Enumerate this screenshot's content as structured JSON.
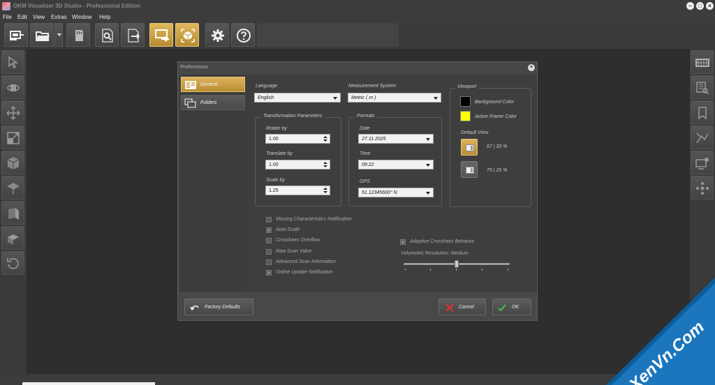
{
  "app": {
    "title": "OKM Visualizer 3D Studio - Professional Edition"
  },
  "window_controls": {
    "minimize": "–",
    "maximize": "□",
    "close": "×"
  },
  "menu": [
    "File",
    "Edit",
    "View",
    "Extras",
    "Window",
    "Help"
  ],
  "toolbar": {
    "buttons": [
      {
        "name": "connect-device",
        "icon": "device-connect-icon",
        "active": false
      },
      {
        "name": "open-file",
        "icon": "folder-open-icon",
        "active": false
      },
      {
        "name": "sd-card",
        "icon": "sd-card-icon",
        "active": false
      },
      {
        "name": "search-scan",
        "icon": "search-document-icon",
        "active": false
      },
      {
        "name": "export",
        "icon": "export-document-icon",
        "active": false
      },
      {
        "name": "screenshot",
        "icon": "screen-capture-icon",
        "active": true
      },
      {
        "name": "3d-view",
        "icon": "cube-select-icon",
        "active": true
      },
      {
        "name": "settings",
        "icon": "gear-icon",
        "active": false
      },
      {
        "name": "help",
        "icon": "question-icon",
        "active": false
      }
    ]
  },
  "dialog": {
    "title": "Preferences",
    "close": "×",
    "nav": [
      {
        "label": "General",
        "active": true
      },
      {
        "label": "Folders",
        "active": false
      }
    ],
    "language": {
      "label": "Language",
      "value": "English"
    },
    "measurement": {
      "label": "Measurement System",
      "value": "Metric ( m )"
    },
    "transformation": {
      "title": "Transformation Parameters",
      "rotate": {
        "label": "Rotate by",
        "value": "1.00"
      },
      "translate": {
        "label": "Translate by",
        "value": "1.00"
      },
      "scale": {
        "label": "Scale by",
        "value": "1.25"
      }
    },
    "formats": {
      "title": "Formats",
      "date": {
        "label": "Date",
        "value": "27.11.2025"
      },
      "time": {
        "label": "Time",
        "value": "09:22"
      },
      "gps": {
        "label": "GPS",
        "value": "51.12345600° N"
      }
    },
    "viewport": {
      "title": "Viewport",
      "background_color": {
        "label": "Background Color",
        "color": "#000000"
      },
      "active_frame_color": {
        "label": "Active Frame Color",
        "color": "#ffff00"
      },
      "default_view_label": "Default View",
      "views": [
        {
          "label": "67  |  33 %",
          "active": true
        },
        {
          "label": "75  |  25 %",
          "active": false
        }
      ]
    },
    "checkboxes": [
      {
        "label": "Missing Characteristics Notification",
        "checked": false
      },
      {
        "label": "Auto-Scale",
        "checked": true
      },
      {
        "label": "Crosshairs Overflow",
        "checked": false
      },
      {
        "label": "Raw Scan Value",
        "checked": false
      },
      {
        "label": "Advanced Scan Information",
        "checked": false
      },
      {
        "label": "Online Update Notification",
        "checked": true
      }
    ],
    "adaptive_crosshairs": {
      "label": "Adaptive Crosshairs Behavior",
      "checked": true
    },
    "volumetric": {
      "label": "Volumetric Resolution: Medium",
      "level": 0.5
    },
    "footer": {
      "factory_defaults": "Factory Defaults",
      "cancel": "Cancel",
      "ok": "OK"
    }
  },
  "watermark": {
    "text": "XenVn.Com"
  },
  "colors": {
    "accent": "#d4a94f",
    "workspace": "#2e2e2e",
    "cancel_icon": "#e03030",
    "ok_icon": "#44cc44"
  }
}
